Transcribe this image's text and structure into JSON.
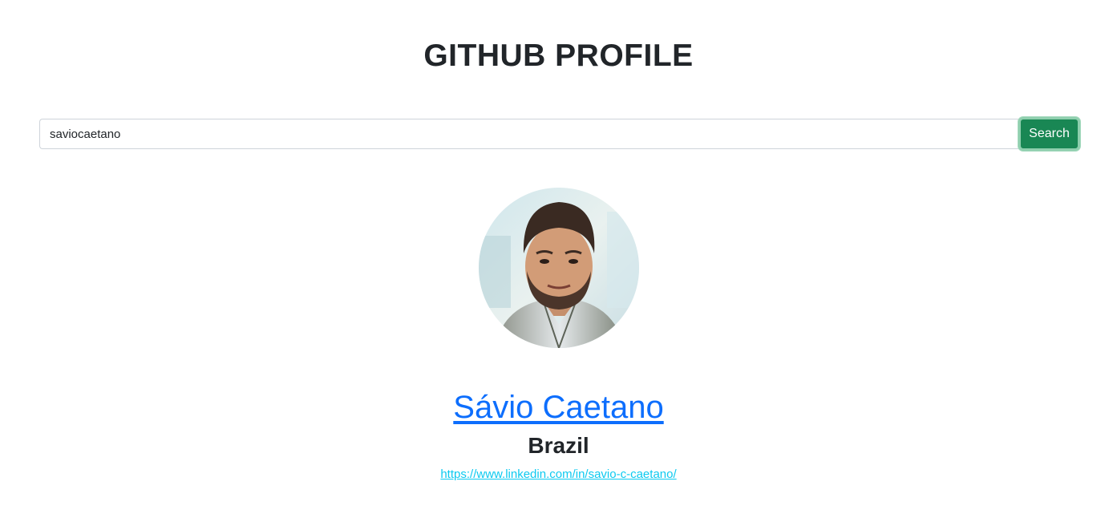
{
  "header": {
    "title": "GITHUB PROFILE"
  },
  "search": {
    "value": "saviocaetano",
    "button_label": "Search"
  },
  "profile": {
    "name": "Sávio Caetano",
    "location": "Brazil",
    "blog_url": "https://www.linkedin.com/in/savio-c-caetano/",
    "avatar_icon": "user-avatar-photo"
  },
  "colors": {
    "button_bg": "#198754",
    "link_primary": "#0d6efd",
    "link_info": "#0dcaf0"
  }
}
